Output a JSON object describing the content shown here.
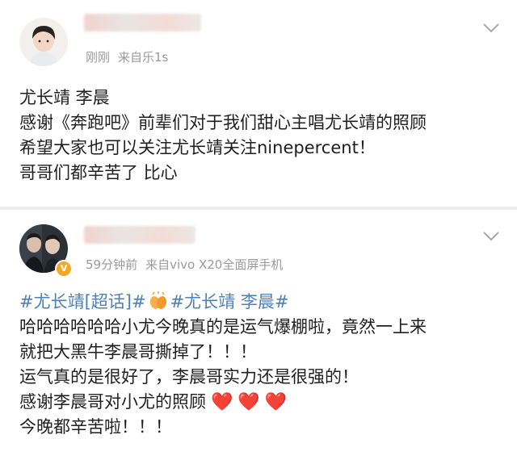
{
  "post1": {
    "time": "刚刚",
    "source": "来自乐1s",
    "lines": [
      "尤长靖 李晨",
      "感谢《奔跑吧》前辈们对于我们甜心主唱尤长靖的照顾",
      "希望大家也可以关注尤长靖关注ninepercent！",
      "哥哥们都辛苦了 比心"
    ]
  },
  "post2": {
    "time": "59分钟前",
    "source": "来自vivo X20全面屏手机",
    "topic_line": {
      "topic1": "#尤长靖[超话]#",
      "topic2": "#尤长靖 李晨#"
    },
    "lines": [
      "哈哈哈哈哈哈小尤今晚真的是运气爆棚啦，竟然一上来",
      "就把大黑牛李晨哥撕掉了！！！",
      "运气真的是很好了，李晨哥实力还是很强的！",
      "感谢李晨哥对小尤的照顾",
      "今晚都辛苦啦！！！"
    ],
    "hearts": [
      "❤️",
      "❤️",
      "❤️"
    ]
  },
  "icons": {
    "chevron": "chevron-down-icon",
    "verified": "verified-badge-icon",
    "hands": "clapping-hands-emoji",
    "heart": "red-heart-emoji"
  },
  "colors": {
    "topic": "#4f7fb8",
    "meta": "#9a9a9a",
    "text": "#1f1f1f",
    "heart": "#e0242c",
    "verified": "#f5a623"
  }
}
